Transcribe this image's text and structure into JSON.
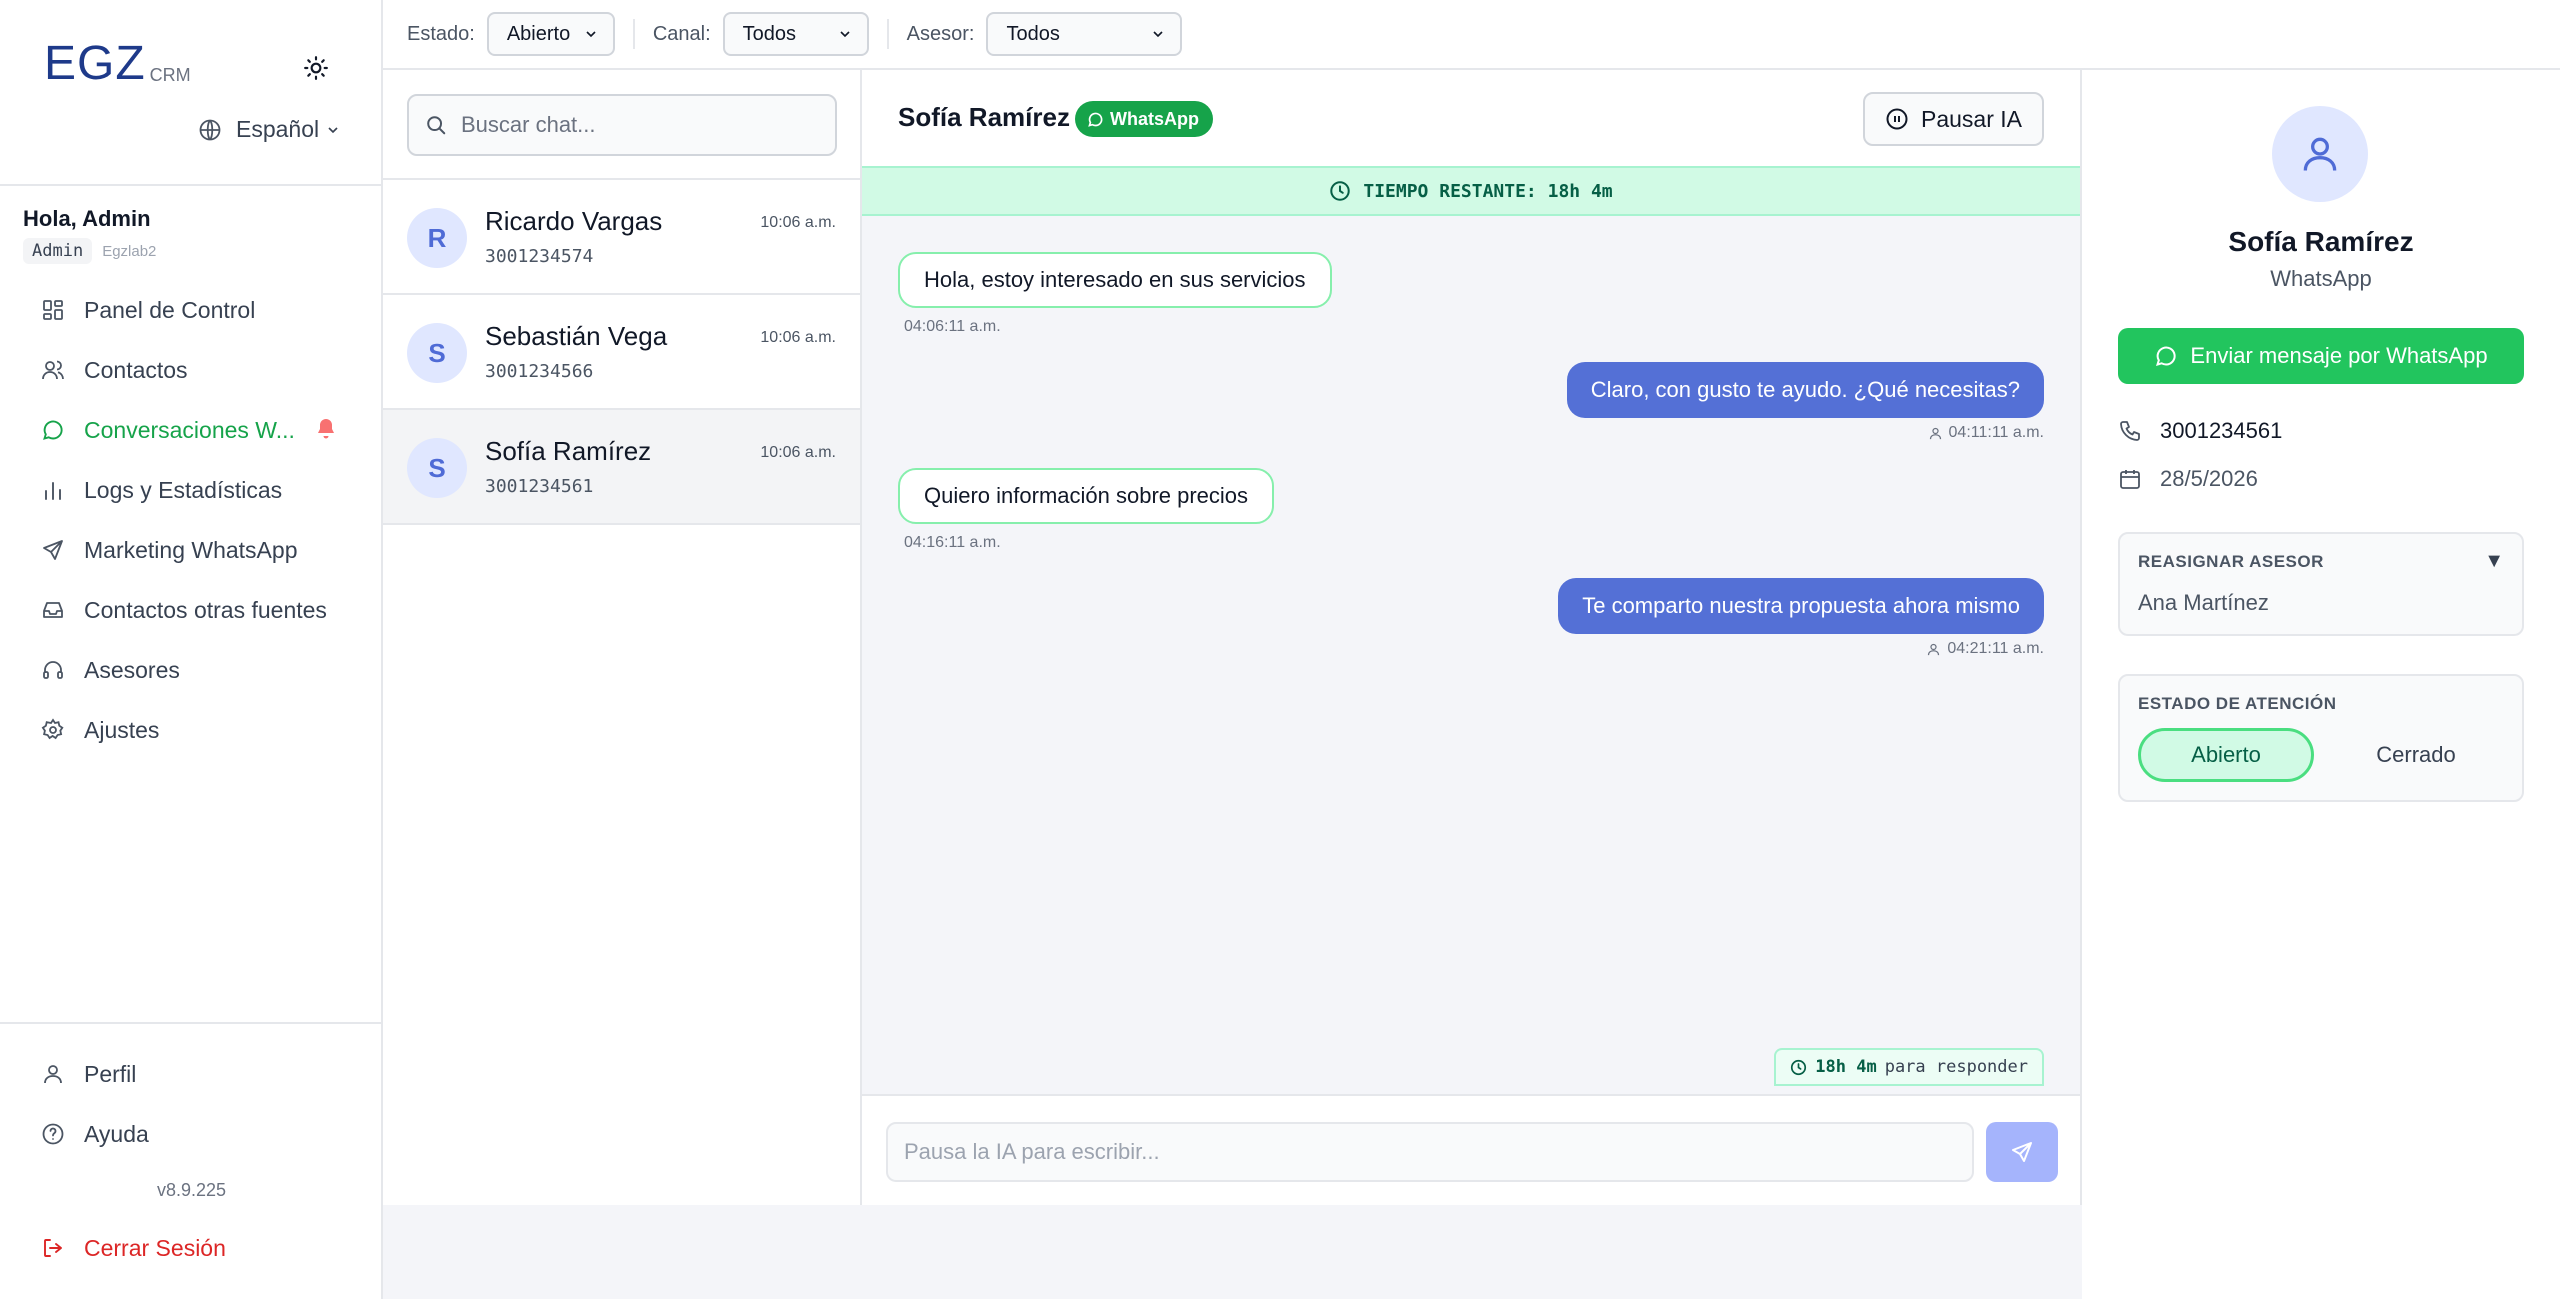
{
  "brand": {
    "name": "EGZ",
    "suffix": "CRM"
  },
  "sidebar": {
    "language": "Español",
    "greeting": "Hola, Admin",
    "role": "Admin",
    "org": "Egzlab2",
    "items": [
      {
        "label": "Panel de Control",
        "icon": "dashboard-icon"
      },
      {
        "label": "Contactos",
        "icon": "users-icon"
      },
      {
        "label": "Conversaciones W...",
        "icon": "whatsapp-icon",
        "active": true
      },
      {
        "label": "Logs y Estadísticas",
        "icon": "bar-chart-icon"
      },
      {
        "label": "Marketing WhatsApp",
        "icon": "send-icon"
      },
      {
        "label": "Contactos otras fuentes",
        "icon": "inbox-icon"
      },
      {
        "label": "Asesores",
        "icon": "headset-icon"
      },
      {
        "label": "Ajustes",
        "icon": "gear-icon"
      }
    ],
    "bottom": [
      {
        "label": "Perfil",
        "icon": "user-icon"
      },
      {
        "label": "Ayuda",
        "icon": "help-icon"
      }
    ],
    "version": "v8.9.225",
    "logout": "Cerrar Sesión"
  },
  "filters": {
    "estado_label": "Estado:",
    "estado_value": "Abierto",
    "canal_label": "Canal:",
    "canal_value": "Todos",
    "asesor_label": "Asesor:",
    "asesor_value": "Todos"
  },
  "chatlist": {
    "search_placeholder": "Buscar chat...",
    "chats": [
      {
        "initial": "R",
        "name": "Ricardo Vargas",
        "phone": "3001234574",
        "time": "10:06 a.m."
      },
      {
        "initial": "S",
        "name": "Sebastián Vega",
        "phone": "3001234566",
        "time": "10:06 a.m."
      },
      {
        "initial": "S",
        "name": "Sofía Ramírez",
        "phone": "3001234561",
        "time": "10:06 a.m.",
        "selected": true
      }
    ]
  },
  "conversation": {
    "contact_name": "Sofía Ramírez",
    "channel_badge": "WhatsApp",
    "pause_label": "Pausar IA",
    "timer_banner": "TIEMPO RESTANTE: 18h 4m",
    "messages": [
      {
        "direction": "in",
        "text": "Hola, estoy interesado en sus servicios",
        "time": "04:06:11 a.m."
      },
      {
        "direction": "out",
        "text": "Claro, con gusto te ayudo. ¿Qué necesitas?",
        "time": "04:11:11 a.m."
      },
      {
        "direction": "in",
        "text": "Quiero información sobre precios",
        "time": "04:16:11 a.m."
      },
      {
        "direction": "out",
        "text": "Te comparto nuestra propuesta ahora mismo",
        "time": "04:21:11 a.m."
      }
    ],
    "respond_time": "18h 4m",
    "respond_suffix": "para responder",
    "composer_placeholder": "Pausa la IA para escribir..."
  },
  "contact_panel": {
    "name": "Sofía Ramírez",
    "channel": "WhatsApp",
    "whatsapp_button": "Enviar mensaje por WhatsApp",
    "phone": "3001234561",
    "date": "28/5/2026",
    "reassign_label": "REASIGNAR ASESOR",
    "reassign_value": "Ana Martínez",
    "state_label": "ESTADO DE ATENCIÓN",
    "state_open": "Abierto",
    "state_closed": "Cerrado"
  },
  "colors": {
    "accent": "#16a34a",
    "outgoing_bubble": "#5470d6",
    "brand": "#1e3a8a",
    "danger": "#dc2626"
  }
}
